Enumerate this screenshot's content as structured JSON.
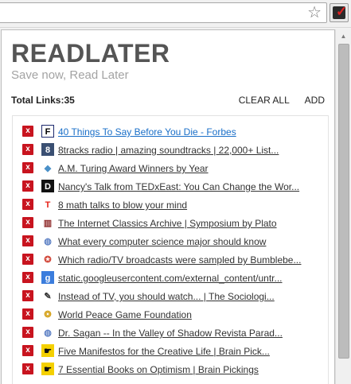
{
  "browser": {
    "star_icon": "star-icon",
    "extension_icon": "readlater-extension-icon"
  },
  "popup": {
    "title": "READLATER",
    "subtitle": "Save now, Read Later",
    "total_label": "Total Links:",
    "total_count": "35",
    "clear_all": "CLEAR ALL",
    "add": "ADD",
    "delete_label": "x",
    "items": [
      {
        "label": "40 Things To Say Before You Die - Forbes",
        "favicon": "forbes-icon",
        "fav_text": "F",
        "fav_bg": "#ffffff",
        "fav_fg": "#000000",
        "fav_border": "#1d2a6e"
      },
      {
        "label": "8tracks radio | amazing soundtracks | 22,000+ List...",
        "favicon": "8tracks-icon",
        "fav_text": "8",
        "fav_bg": "#3a4f72",
        "fav_fg": "#ffffff",
        "fav_border": "#3a4f72"
      },
      {
        "label": "A.M. Turing Award Winners by Year",
        "favicon": "diamond-icon",
        "fav_text": "◆",
        "fav_bg": "#ffffff",
        "fav_fg": "#4a90c8",
        "fav_border": "#ffffff"
      },
      {
        "label": "Nancy's Talk from TEDxEast: You Can Change the Wor...",
        "favicon": "d-icon",
        "fav_text": "D",
        "fav_bg": "#111111",
        "fav_fg": "#ffffff",
        "fav_border": "#111111"
      },
      {
        "label": "8 math talks to blow your mind",
        "favicon": "ted-icon",
        "fav_text": "T",
        "fav_bg": "#ffffff",
        "fav_fg": "#e62117",
        "fav_border": "#ffffff"
      },
      {
        "label": "The Internet Classics Archive | Symposium by Plato",
        "favicon": "archive-icon",
        "fav_text": "▥",
        "fav_bg": "#ffffff",
        "fav_fg": "#8a2222",
        "fav_border": "#ffffff"
      },
      {
        "label": "What every computer science major should know",
        "favicon": "globe-icon",
        "fav_text": "◍",
        "fav_bg": "#ffffff",
        "fav_fg": "#5b7fc4",
        "fav_border": "#ffffff"
      },
      {
        "label": "Which radio/TV broadcasts were sampled by Bumblebe...",
        "favicon": "reddit-icon",
        "fav_text": "✪",
        "fav_bg": "#ffffff",
        "fav_fg": "#d24a3c",
        "fav_border": "#ffffff"
      },
      {
        "label": "static.googleusercontent.com/external_content/untr...",
        "favicon": "google-icon",
        "fav_text": "g",
        "fav_bg": "#3b7ddd",
        "fav_fg": "#ffffff",
        "fav_border": "#3b7ddd"
      },
      {
        "label": "Instead of TV, you should watch... | The Sociologi...",
        "favicon": "sociological-icon",
        "fav_text": "✎",
        "fav_bg": "#ffffff",
        "fav_fg": "#333333",
        "fav_border": "#ffffff"
      },
      {
        "label": "World Peace Game Foundation",
        "favicon": "peace-icon",
        "fav_text": "❂",
        "fav_bg": "#ffffff",
        "fav_fg": "#d4a017",
        "fav_border": "#ffffff"
      },
      {
        "label": "Dr. Sagan -- In the Valley of Shadow Revista Parad...",
        "favicon": "globe-icon",
        "fav_text": "◍",
        "fav_bg": "#ffffff",
        "fav_fg": "#5b7fc4",
        "fav_border": "#ffffff"
      },
      {
        "label": "Five Manifestos for the Creative Life | Brain Pick...",
        "favicon": "brainpickings-icon",
        "fav_text": "☛",
        "fav_bg": "#f4d000",
        "fav_fg": "#111111",
        "fav_border": "#f4d000"
      },
      {
        "label": "7 Essential Books on Optimism | Brain Pickings",
        "favicon": "brainpickings-icon",
        "fav_text": "☛",
        "fav_bg": "#f4d000",
        "fav_fg": "#111111",
        "fav_border": "#f4d000"
      }
    ]
  }
}
